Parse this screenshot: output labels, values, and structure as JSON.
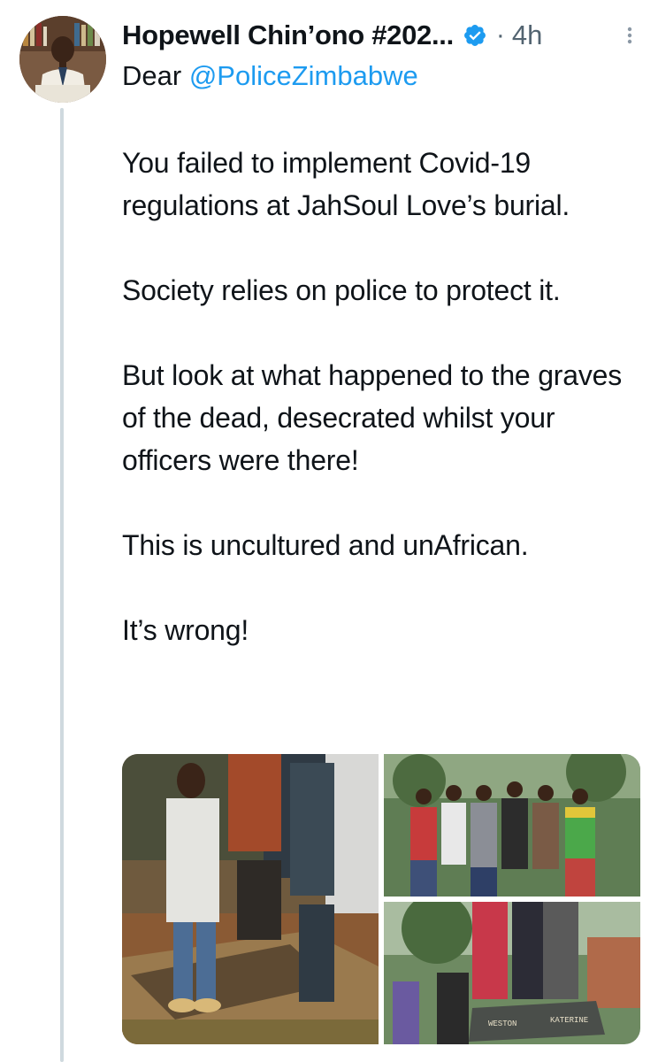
{
  "tweet": {
    "author_name": "Hopewell Chin’ono #202...",
    "timestamp": "4h",
    "separator": "·",
    "reply_prefix": "Dear",
    "mention": "@PoliceZimbabwe",
    "paragraphs": [
      "You failed to implement Covid-19 regulations at JahSoul Love’s burial.",
      "Society relies on police to protect it.",
      "But look at what happened to the graves of the dead, desecrated whilst your officers were there!",
      "This is uncultured and unAfrican.",
      "It’s wrong!"
    ]
  },
  "icons": {
    "verified": "verified-badge-icon",
    "more": "more-options-icon"
  },
  "media": {
    "photo_count": 3,
    "photo_3_sign_left": "WESTON",
    "photo_3_sign_right": "KATERINE"
  },
  "colors": {
    "accent": "#1d9bf0",
    "text": "#0f1419",
    "secondary": "#536471",
    "thread_line": "#cfd9de"
  }
}
